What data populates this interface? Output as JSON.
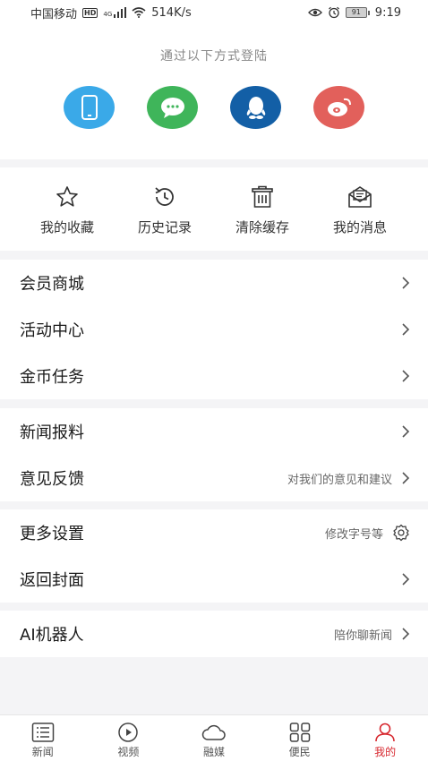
{
  "status": {
    "carrier": "中国移动",
    "hd": "HD",
    "net_gen": "4G",
    "speed": "514K/s",
    "battery": "91",
    "time": "9:19"
  },
  "login": {
    "title": "通过以下方式登陆",
    "methods": [
      {
        "icon": "phone-icon",
        "color": "#3aa9e8"
      },
      {
        "icon": "wechat-icon",
        "color": "#3fb55a"
      },
      {
        "icon": "qq-icon",
        "color": "#135fa6"
      },
      {
        "icon": "weibo-icon",
        "color": "#e2605b"
      }
    ]
  },
  "quick": [
    {
      "label": "我的收藏",
      "icon": "star-icon"
    },
    {
      "label": "历史记录",
      "icon": "history-icon"
    },
    {
      "label": "清除缓存",
      "icon": "trash-icon"
    },
    {
      "label": "我的消息",
      "icon": "mail-icon"
    }
  ],
  "menu": {
    "group1": [
      {
        "title": "会员商城"
      },
      {
        "title": "活动中心"
      },
      {
        "title": "金币任务"
      }
    ],
    "group2": [
      {
        "title": "新闻报料",
        "hint": ""
      },
      {
        "title": "意见反馈",
        "hint": "对我们的意见和建议"
      }
    ],
    "group3": [
      {
        "title": "更多设置",
        "hint": "修改字号等"
      },
      {
        "title": "返回封面",
        "hint": ""
      }
    ],
    "group4": [
      {
        "title": "AI机器人",
        "hint": "陪你聊新闻"
      }
    ]
  },
  "nav": [
    {
      "label": "新闻",
      "icon": "news-icon",
      "active": false
    },
    {
      "label": "视频",
      "icon": "video-icon",
      "active": false
    },
    {
      "label": "融媒",
      "icon": "cloud-icon",
      "active": false
    },
    {
      "label": "便民",
      "icon": "grid-icon",
      "active": false
    },
    {
      "label": "我的",
      "icon": "user-icon",
      "active": true
    }
  ],
  "colors": {
    "accent": "#d7282f",
    "background": "#f4f4f6"
  }
}
